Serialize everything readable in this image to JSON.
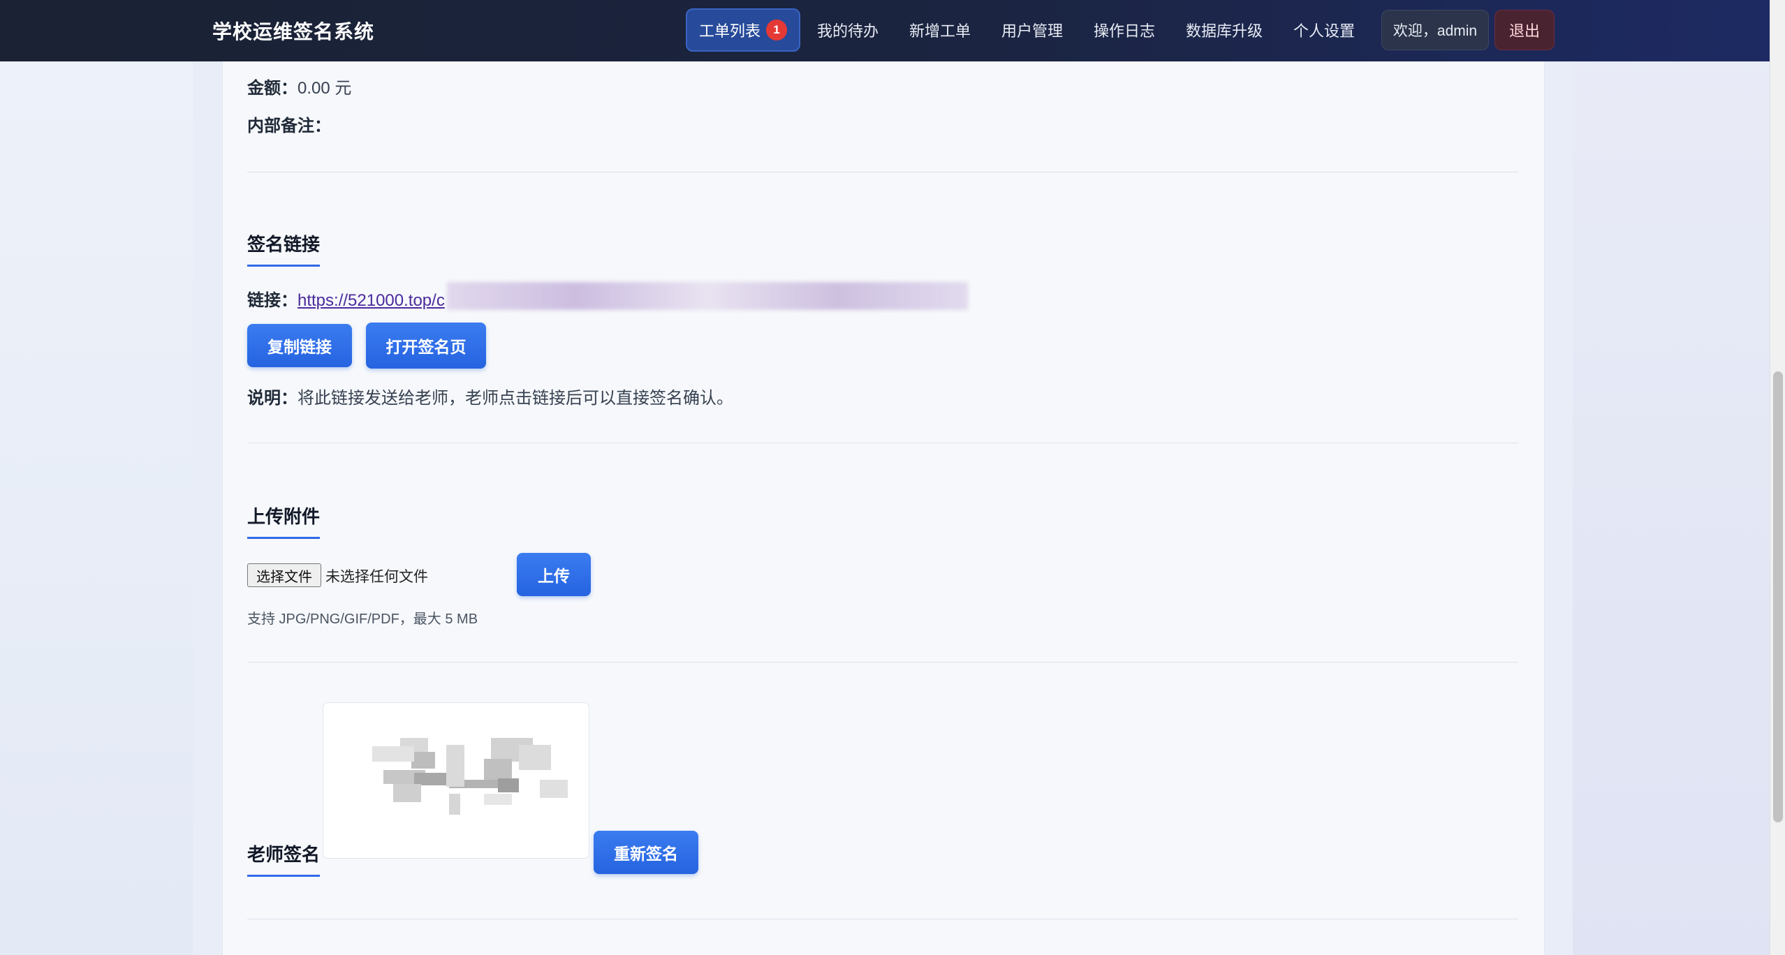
{
  "nav": {
    "brand": "学校运维签名系统",
    "items": [
      {
        "label": "工单列表",
        "badge": "1",
        "active": true
      },
      {
        "label": "我的待办"
      },
      {
        "label": "新增工单"
      },
      {
        "label": "用户管理"
      },
      {
        "label": "操作日志"
      },
      {
        "label": "数据库升级"
      },
      {
        "label": "个人设置"
      }
    ],
    "welcome": "欢迎，admin",
    "logout": "退出"
  },
  "details": {
    "amount_label": "金额：",
    "amount_value": "0.00 元",
    "notes_label": "内部备注："
  },
  "sign_link": {
    "title": "签名链接",
    "link_label": "链接：",
    "link_text": "https://521000.top/c",
    "copy_button": "复制链接",
    "open_button": "打开签名页",
    "note_label": "说明：",
    "note_text": "将此链接发送给老师，老师点击链接后可以直接签名确认。"
  },
  "upload": {
    "title": "上传附件",
    "choose_file": "选择文件",
    "no_file": "未选择任何文件",
    "upload_button": "上传",
    "hint": "支持 JPG/PNG/GIF/PDF，最大 5 MB"
  },
  "signature": {
    "title": "老师签名",
    "resign_button": "重新签名"
  },
  "colors": {
    "accent": "#2563e0",
    "nav_bg": "#1b2440",
    "badge": "#e53935"
  }
}
